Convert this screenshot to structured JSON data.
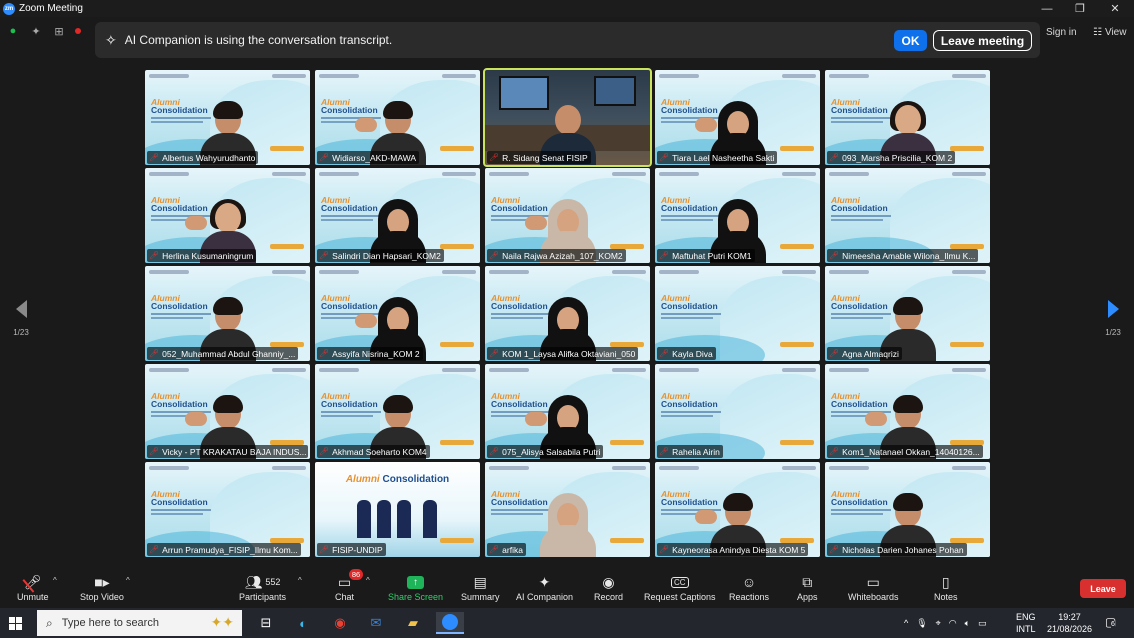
{
  "window": {
    "title": "Zoom Meeting",
    "minimize": "—",
    "maximize": "❐",
    "close": "✕"
  },
  "banner": {
    "text": "AI Companion is using the conversation transcript.",
    "ok_label": "OK",
    "leave_label": "Leave meeting"
  },
  "header": {
    "signin": "Sign in",
    "view": "View"
  },
  "pagination": {
    "left": "1/23",
    "right": "1/23"
  },
  "participants": [
    {
      "name": "Albertus Wahyurudhanto",
      "type": "man-glasses"
    },
    {
      "name": "Widiarso_AKD-MAWA",
      "type": "man"
    },
    {
      "name": "R. Sidang Senat FISIP",
      "type": "room",
      "speaking": true
    },
    {
      "name": "Tiara Lael Nasheetha Sakti",
      "type": "hijab"
    },
    {
      "name": "093_Marsha Priscilia_KOM 2",
      "type": "woman"
    },
    {
      "name": "Herlina Kusumaningrum",
      "type": "woman"
    },
    {
      "name": "Salindri Dian Hapsari_KOM2",
      "type": "hijab-glasses"
    },
    {
      "name": "Naila Rajwa Azizah_107_KOM2",
      "type": "hijab-light"
    },
    {
      "name": "Maftuhat Putri KOM1",
      "type": "hijab"
    },
    {
      "name": "Nimeesha Amable Wilona_Ilmu K...",
      "type": "empty"
    },
    {
      "name": "052_Muhammad Abdul Ghanniy_...",
      "type": "man"
    },
    {
      "name": "Assyifa Nisrina_KOM 2",
      "type": "hijab"
    },
    {
      "name": "KOM 1_Laysa Alifka Oktaviani_050",
      "type": "hijab"
    },
    {
      "name": "Kayla Diva",
      "type": "empty"
    },
    {
      "name": "Agna Almaqrizi",
      "type": "man"
    },
    {
      "name": "Vicky - PT KRAKATAU BAJA INDUS...",
      "type": "man-glasses"
    },
    {
      "name": "Akhmad Soeharto KOM4",
      "type": "man"
    },
    {
      "name": "075_Alisya Salsabila Putri",
      "type": "hijab"
    },
    {
      "name": "Rahelia Airin",
      "type": "empty"
    },
    {
      "name": "Kom1_Natanael Okkan_14040126...",
      "type": "man"
    },
    {
      "name": "Arrun Pramudya_FISIP_Ilmu Kom...",
      "type": "empty"
    },
    {
      "name": "FISIP-UNDIP",
      "type": "fisip"
    },
    {
      "name": "arfika",
      "type": "hijab-light"
    },
    {
      "name": "Kayneorasa Anindya Diesta KOM 5",
      "type": "man"
    },
    {
      "name": "Nicholas Darien Johanes Pohan",
      "type": "man"
    }
  ],
  "tile_brand": {
    "line1": "Alumni",
    "line2": "Consolidation"
  },
  "fisip_title": {
    "a": "Alumni",
    "b": "Consolidation"
  },
  "toolbar": {
    "unmute": "Unmute",
    "stop_video": "Stop Video",
    "participants": "Participants",
    "participants_count": "552",
    "chat": "Chat",
    "chat_badge": "86",
    "share_screen": "Share Screen",
    "summary": "Summary",
    "ai_companion": "AI Companion",
    "record": "Record",
    "captions": "Request Captions",
    "reactions": "Reactions",
    "apps": "Apps",
    "whiteboards": "Whiteboards",
    "notes": "Notes",
    "leave": "Leave"
  },
  "taskbar": {
    "search_placeholder": "Type here to search",
    "lang_line1": "ENG",
    "lang_line2": "INTL",
    "time": "19:27",
    "date": "21/08/2026",
    "notifications": "6"
  },
  "colors": {
    "accent": "#0e71eb",
    "share": "#1fb35a",
    "leave": "#d8302f",
    "speaking": "#c9e45a"
  }
}
